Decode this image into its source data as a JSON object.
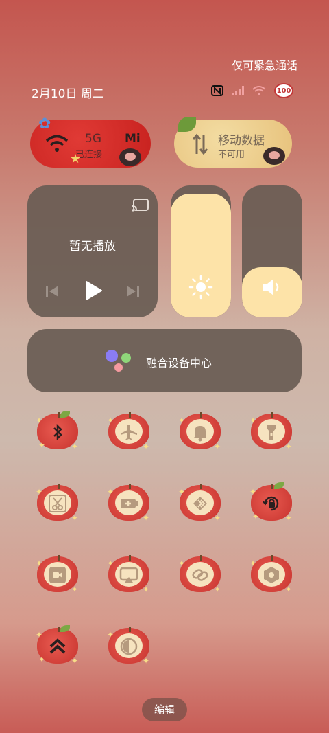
{
  "status": {
    "emergency_text": "仅可紧急通话",
    "date": "2月10日 周二",
    "battery": "100"
  },
  "connectivity": {
    "wifi": {
      "network_label": "5G",
      "status": "已连接",
      "brand": "Mi"
    },
    "mobile": {
      "title": "移动数据",
      "status": "不可用"
    }
  },
  "media": {
    "title": "暂无播放"
  },
  "brightness": {
    "level_percent": 94
  },
  "volume": {
    "level_percent": 38
  },
  "fusion": {
    "label": "融合设备中心"
  },
  "toggles": [
    {
      "name": "bluetooth",
      "icon": "bluetooth-icon",
      "active": true
    },
    {
      "name": "airplane",
      "icon": "airplane-icon",
      "active": false
    },
    {
      "name": "sound",
      "icon": "bell-icon",
      "active": false
    },
    {
      "name": "flashlight",
      "icon": "flashlight-icon",
      "active": false
    },
    {
      "name": "screenshot",
      "icon": "scissors-icon",
      "active": false
    },
    {
      "name": "battery-saver",
      "icon": "battery-plus-icon",
      "active": false
    },
    {
      "name": "transfer",
      "icon": "transfer-icon",
      "active": false
    },
    {
      "name": "auto-rotate",
      "icon": "rotate-lock-icon",
      "active": true
    },
    {
      "name": "screen-record",
      "icon": "video-icon",
      "active": false
    },
    {
      "name": "cast",
      "icon": "cast-icon",
      "active": false
    },
    {
      "name": "link",
      "icon": "link-icon",
      "active": false
    },
    {
      "name": "settings",
      "icon": "hexagon-icon",
      "active": false
    },
    {
      "name": "performance",
      "icon": "chevrons-up-icon",
      "active": true
    },
    {
      "name": "dark-mode",
      "icon": "contrast-icon",
      "active": false
    }
  ],
  "footer": {
    "edit_label": "编辑"
  },
  "colors": {
    "accent_red": "#c8221f",
    "cream": "#f6e3bf",
    "slider_fill": "#fde3a8"
  }
}
